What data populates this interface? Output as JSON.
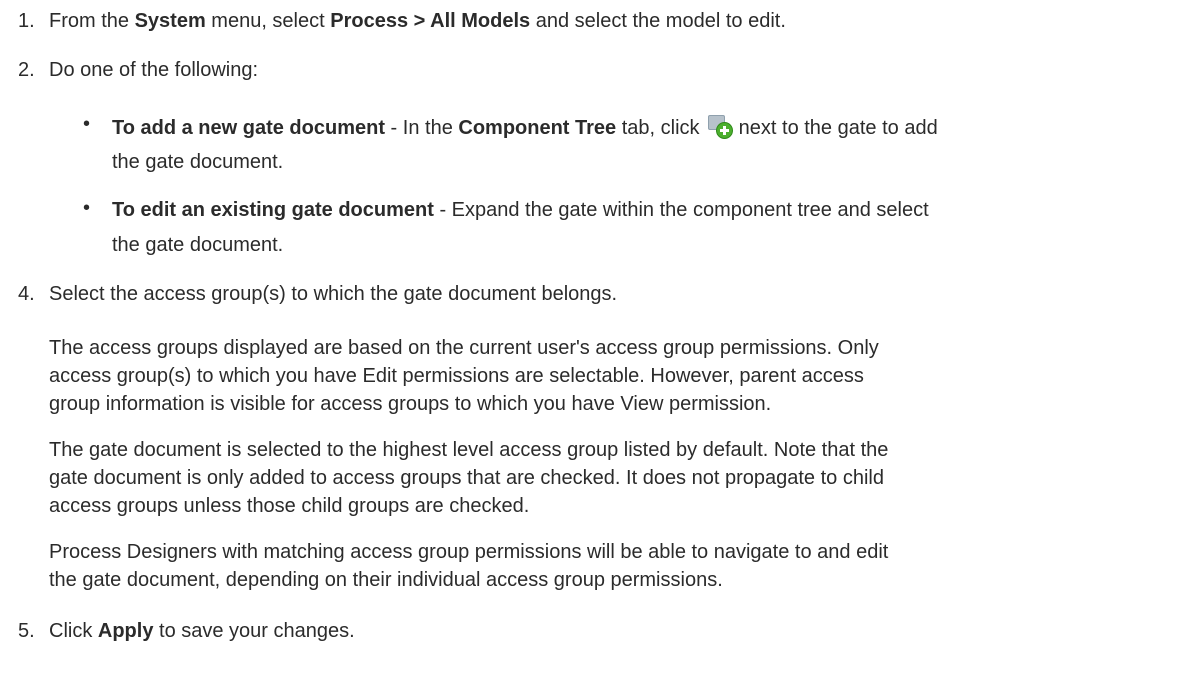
{
  "steps": {
    "s1": {
      "num": "1.",
      "t1": "From the ",
      "b1": "System",
      "t2": " menu, select ",
      "b2": "Process > All Models",
      "t3": " and select the model to edit."
    },
    "s2": {
      "num": "2.",
      "text": "Do one of the following:"
    },
    "bullet_a": {
      "b1": "To add a new gate document",
      "t1": " - In the ",
      "b2": "Component Tree",
      "t2": " tab, click ",
      "icon": "add-gate-document-icon",
      "t3": " next to the gate to add",
      "line2": "the gate document."
    },
    "bullet_b": {
      "b1": "To edit an existing gate document",
      "t1": " - Expand the gate within the component tree and select",
      "line2": "the gate document."
    },
    "s4": {
      "num": "4.",
      "text": "Select the access group(s) to which the gate document belongs."
    },
    "para1": {
      "l1": "The access groups displayed are based on the current user's access group permissions. Only",
      "l2": "access group(s) to which you have Edit permissions are selectable. However, parent access",
      "l3": "group information is visible for access groups to which you have View permission."
    },
    "para2": {
      "l1": "The gate document is selected to the highest level access group listed by default. Note that the",
      "l2": "gate document is only added to access groups that are checked. It does not propagate to child",
      "l3": "access groups unless those child groups are checked."
    },
    "para3": {
      "l1": "Process Designers with matching access group permissions will be able to navigate to and edit",
      "l2": "the gate document, depending on their individual access group permissions."
    },
    "s5": {
      "num": "5.",
      "t1": "Click ",
      "b1": "Apply",
      "t2": " to save your changes."
    }
  }
}
